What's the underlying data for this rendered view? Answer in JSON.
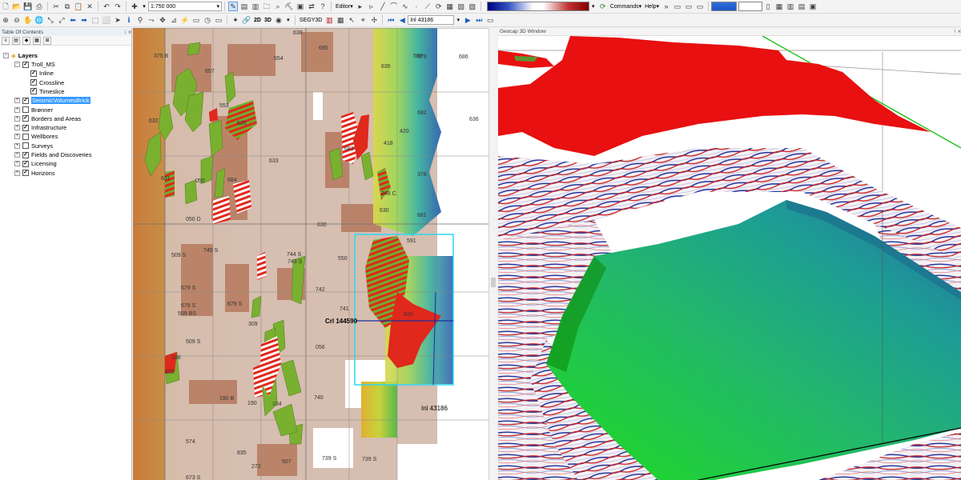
{
  "toolbar1": {
    "scale_value": "1:750 000",
    "editor_label": "Editor▾",
    "segy_label": "SEGY3D",
    "inline_value": "Inl 43186",
    "commands_label": "Commands",
    "help_label": "Help",
    "mode_2d": "2D",
    "mode_3d": "3D"
  },
  "toc": {
    "title": "Table Of Contents",
    "root_label": "Layers",
    "items": [
      {
        "label": "Troll_MS",
        "checked": true,
        "expanded": true
      },
      {
        "label": "Inline",
        "checked": true
      },
      {
        "label": "Crossline",
        "checked": true
      },
      {
        "label": "Timeslice",
        "checked": true
      },
      {
        "label": "SeismicVolumesBrick",
        "checked": true,
        "selected": true
      },
      {
        "label": "Brønner",
        "checked": false
      },
      {
        "label": "Borders and Areas",
        "checked": true
      },
      {
        "label": "Infrastructure",
        "checked": true
      },
      {
        "label": "Wellbores",
        "checked": false
      },
      {
        "label": "Surveys",
        "checked": false
      },
      {
        "label": "Fields and Discoveries",
        "checked": true
      },
      {
        "label": "Licensing",
        "checked": true
      },
      {
        "label": "Horizons",
        "checked": true
      }
    ]
  },
  "map": {
    "block_labels": [
      "638",
      "685",
      "586",
      "579",
      "686",
      "375 B",
      "554",
      "635",
      "657",
      "682",
      "636",
      "632",
      "553",
      "620",
      "418",
      "420",
      "683",
      "631",
      "633",
      "378",
      "050",
      "684",
      "248 C",
      "630",
      "681",
      "050 D",
      "630",
      "745 S",
      "744 S",
      "743 S",
      "550",
      "509 S",
      "679 S",
      "742",
      "679 S",
      "679 S",
      "509 BS",
      "741",
      "509 S",
      "309",
      "056",
      "190 B",
      "740",
      "190",
      "574",
      "104",
      "835",
      "272",
      "507",
      "739 S",
      "739 S",
      "673 S",
      "591",
      "038",
      "650",
      "420"
    ],
    "crossline_label": "Crl 144590",
    "inline_label": "Inl 43186"
  },
  "geo3d": {
    "title": "Geocap 3D Window"
  },
  "colors": {
    "map_land": "#d8c3bc",
    "license_brown": "#b87d62",
    "field_green": "#7ab030",
    "discovery_red": "#e0281c",
    "selection_cyan": "#2ad8f0"
  }
}
